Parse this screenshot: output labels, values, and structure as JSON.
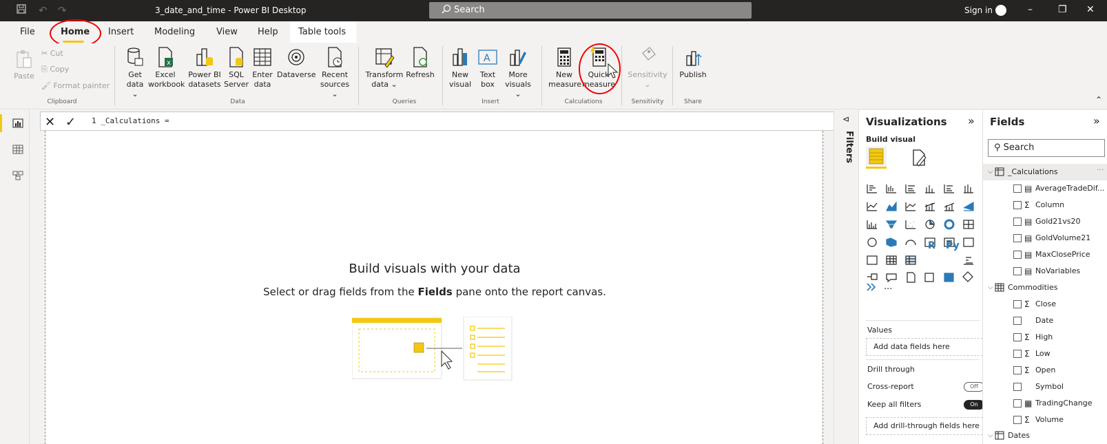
{
  "titlebar": {
    "doc_title": "3_date_and_time - Power BI Desktop",
    "search_placeholder": "Search",
    "sign_in": "Sign in",
    "minimize": "–",
    "restore": "❐",
    "close": "✕",
    "save_icon": "save-icon",
    "undo_icon": "undo-icon",
    "redo_icon": "redo-icon"
  },
  "menu": {
    "file": "File",
    "home": "Home",
    "insert": "Insert",
    "modeling": "Modeling",
    "view": "View",
    "help": "Help",
    "table_tools": "Table tools"
  },
  "ribbon": {
    "paste": "Paste",
    "cut": "Cut",
    "copy": "Copy",
    "format_painter": "Format painter",
    "clipboard": "Clipboard",
    "get_data": "Get",
    "get_data_2": "data ⌄",
    "excel": "Excel",
    "excel_2": "workbook",
    "pbi_datasets": "Power BI",
    "pbi_datasets_2": "datasets",
    "sql": "SQL",
    "sql_2": "Server",
    "enter": "Enter",
    "enter_2": "data",
    "dataverse": "Dataverse",
    "recent": "Recent",
    "recent_2": "sources ⌄",
    "data_group": "Data",
    "transform": "Transform",
    "transform_2": "data ⌄",
    "refresh": "Refresh",
    "queries_group": "Queries",
    "new_visual": "New",
    "new_visual_2": "visual",
    "text_box": "Text",
    "text_box_2": "box",
    "more_visuals": "More",
    "more_visuals_2": "visuals ⌄",
    "insert_group": "Insert",
    "new_measure": "New",
    "new_measure_2": "measure",
    "quick_measure": "Quick",
    "quick_measure_2": "measure",
    "calculations_group": "Calculations",
    "sensitivity": "Sensitivity",
    "sensitivity_2": "⌄",
    "sensitivity_group": "Sensitivity",
    "publish": "Publish",
    "share_group": "Share"
  },
  "formula": {
    "cancel": "✕",
    "commit": "✓",
    "text": "1 _Calculations =",
    "expand": "⌄"
  },
  "canvas": {
    "title": "Build visuals with your data",
    "sub_before": "Select or drag fields from the ",
    "sub_bold": "Fields",
    "sub_after": " pane onto the report canvas."
  },
  "filters": {
    "label": "Filters"
  },
  "visualizations": {
    "title": "Visualizations",
    "collapse": "»",
    "build_visual": "Build visual",
    "r_label": "R",
    "py_label": "Py",
    "more": "···",
    "values": "Values",
    "add_fields": "Add data fields here",
    "drill_through": "Drill through",
    "cross_report": "Cross-report",
    "cross_report_state": "Off",
    "keep_filters": "Keep all filters",
    "keep_filters_state": "On",
    "add_drill": "Add drill-through fields here"
  },
  "fields": {
    "title": "Fields",
    "collapse": "»",
    "search": "Search",
    "tables": [
      {
        "name": "_Calculations",
        "items": [
          "AverageTradeDif...",
          "Column",
          "Gold21vs20",
          "GoldVolume21",
          "MaxClosePrice",
          "NoVariables"
        ]
      },
      {
        "name": "Commodities",
        "items": [
          "Close",
          "Date",
          "High",
          "Low",
          "Open",
          "Symbol",
          "TradingChange",
          "Volume"
        ]
      },
      {
        "name": "Dates",
        "items": []
      }
    ]
  },
  "colors": {
    "accent": "#f2c811",
    "annotation": "#e00000",
    "titlebar": "#252423"
  }
}
